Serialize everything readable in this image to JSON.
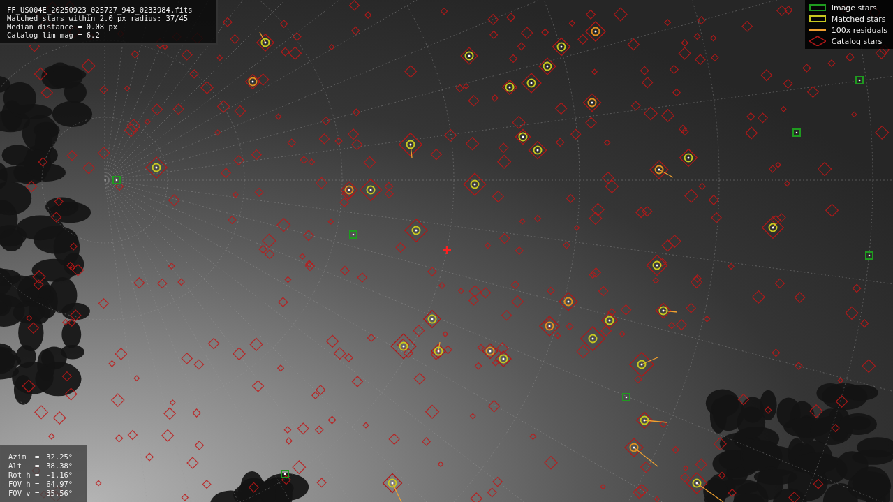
{
  "info_box": {
    "lines": [
      "FF_US004E_20250923_025727_943_0233984.fits",
      "Matched stars within 2.0 px radius: 37/45",
      "Median distance = 0.08 px",
      "Catalog lim mag = 6.2"
    ]
  },
  "legend": [
    {
      "kind": "box",
      "label": "Image stars",
      "color": "#1f9a1f"
    },
    {
      "kind": "box",
      "label": "Matched stars",
      "color": "#c8c820"
    },
    {
      "kind": "line",
      "label": "100x residuals",
      "color": "#f0a030"
    },
    {
      "kind": "diamond",
      "label": "Catalog stars",
      "color": "#b01818"
    }
  ],
  "pointing_box": {
    "rows": [
      {
        "label": "Azim  =",
        "value": "32.25°"
      },
      {
        "label": "Alt   =",
        "value": "38.38°"
      },
      {
        "label": "Rot h =",
        "value": "-1.16°"
      },
      {
        "label": "FOV h =",
        "value": "64.97°"
      },
      {
        "label": "FOV v =",
        "value": "35.56°"
      }
    ]
  }
}
